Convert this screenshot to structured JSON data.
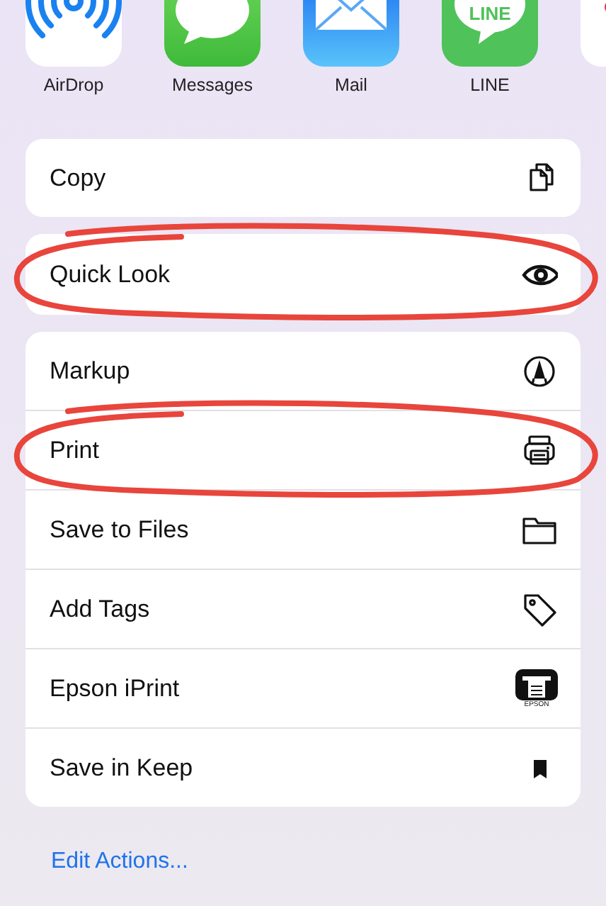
{
  "apps": [
    {
      "label": "AirDrop",
      "kind": "airdrop"
    },
    {
      "label": "Messages",
      "kind": "messages"
    },
    {
      "label": "Mail",
      "kind": "mail"
    },
    {
      "label": "LINE",
      "kind": "line",
      "icon_text": "LINE"
    },
    {
      "kind": "partial"
    }
  ],
  "action_groups": [
    {
      "items": [
        {
          "label": "Copy",
          "kind": "copy",
          "circled": false
        }
      ]
    },
    {
      "items": [
        {
          "label": "Quick Look",
          "kind": "eye",
          "circled": true
        }
      ]
    },
    {
      "items": [
        {
          "label": "Markup",
          "kind": "markup",
          "circled": false
        },
        {
          "label": "Print",
          "kind": "print",
          "circled": true
        },
        {
          "label": "Save to Files",
          "kind": "folder",
          "circled": false
        },
        {
          "label": "Add Tags",
          "kind": "tag",
          "circled": false
        },
        {
          "label": "Epson iPrint",
          "kind": "epson",
          "icon_text": "EPSON",
          "circled": false
        },
        {
          "label": "Save in Keep",
          "kind": "bookmark",
          "circled": false
        }
      ]
    }
  ],
  "edit_actions": "Edit Actions..."
}
